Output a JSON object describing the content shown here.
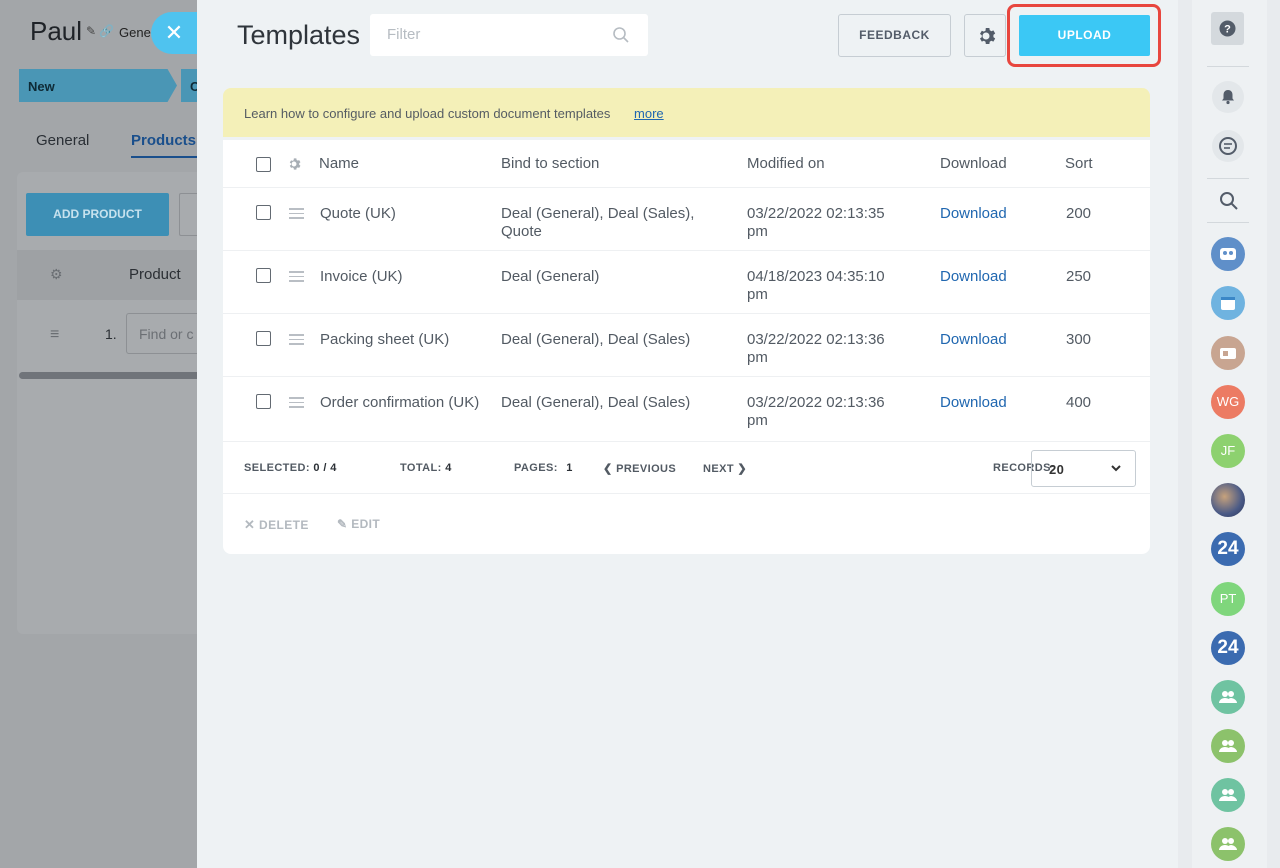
{
  "background": {
    "title": "Paul",
    "title_icons": "✎ 🔗",
    "breadcrumb": "Gene",
    "stage_new": "New",
    "stage_next": "C",
    "tabs": [
      "General",
      "Products"
    ],
    "add_product_label": "ADD PRODUCT",
    "product_column": "Product",
    "row_number": "1.",
    "find_placeholder": "Find or c"
  },
  "panel": {
    "title": "Templates",
    "filter_placeholder": "Filter",
    "feedback_label": "FEEDBACK",
    "upload_label": "UPLOAD",
    "info_text": "Learn how to configure and upload custom document templates",
    "info_more": "more",
    "columns": [
      "Name",
      "Bind to section",
      "Modified on",
      "Download",
      "Sort"
    ],
    "rows": [
      {
        "name": "Quote (UK)",
        "bind": "Deal (General), Deal (Sales), Quote",
        "modified": "03/22/2022 02:13:35 pm",
        "download": "Download",
        "sort": "200"
      },
      {
        "name": "Invoice (UK)",
        "bind": "Deal (General)",
        "modified": "04/18/2023 04:35:10 pm",
        "download": "Download",
        "sort": "250"
      },
      {
        "name": "Packing sheet (UK)",
        "bind": "Deal (General), Deal (Sales)",
        "modified": "03/22/2022 02:13:36 pm",
        "download": "Download",
        "sort": "300"
      },
      {
        "name": "Order confirmation (UK)",
        "bind": "Deal (General), Deal (Sales)",
        "modified": "03/22/2022 02:13:36 pm",
        "download": "Download",
        "sort": "400"
      }
    ],
    "footer": {
      "selected_label": "SELECTED:",
      "selected_value": "0 / 4",
      "total_label": "TOTAL:",
      "total_value": "4",
      "pages_label": "PAGES:",
      "pages_value": "1",
      "previous_label": "PREVIOUS",
      "next_label": "NEXT",
      "records_label": "RECORDS:",
      "records_value": "20"
    },
    "actions": {
      "delete": "DELETE",
      "edit": "EDIT"
    }
  },
  "sidebar": {
    "avatars": [
      {
        "name": "group-chat",
        "text": "",
        "color": "#5f8fc9"
      },
      {
        "name": "calendar",
        "text": "",
        "color": "#6fb3e0"
      },
      {
        "name": "contact-card",
        "text": "",
        "color": "#c8a591"
      },
      {
        "name": "wg",
        "text": "WG",
        "color": "#ec7b63"
      },
      {
        "name": "jf",
        "text": "JF",
        "color": "#8dd16f"
      },
      {
        "name": "photo",
        "text": "",
        "color": "#4a5a86"
      },
      {
        "name": "24-a",
        "text": "24",
        "color": "#3b6bb0"
      },
      {
        "name": "pt",
        "text": "PT",
        "color": "#7fd67c"
      },
      {
        "name": "24-b",
        "text": "24",
        "color": "#3b6bb0"
      },
      {
        "name": "group-1",
        "text": "",
        "color": "#6fc3a1"
      },
      {
        "name": "group-2",
        "text": "",
        "color": "#8cc26b"
      },
      {
        "name": "group-3",
        "text": "",
        "color": "#6fc3a1"
      },
      {
        "name": "group-4",
        "text": "",
        "color": "#8cc26b"
      }
    ]
  },
  "colors": {
    "accent": "#3bc8f5",
    "highlight": "#e8463e",
    "link": "#2067b0",
    "info_bg": "#f4f0b8"
  }
}
